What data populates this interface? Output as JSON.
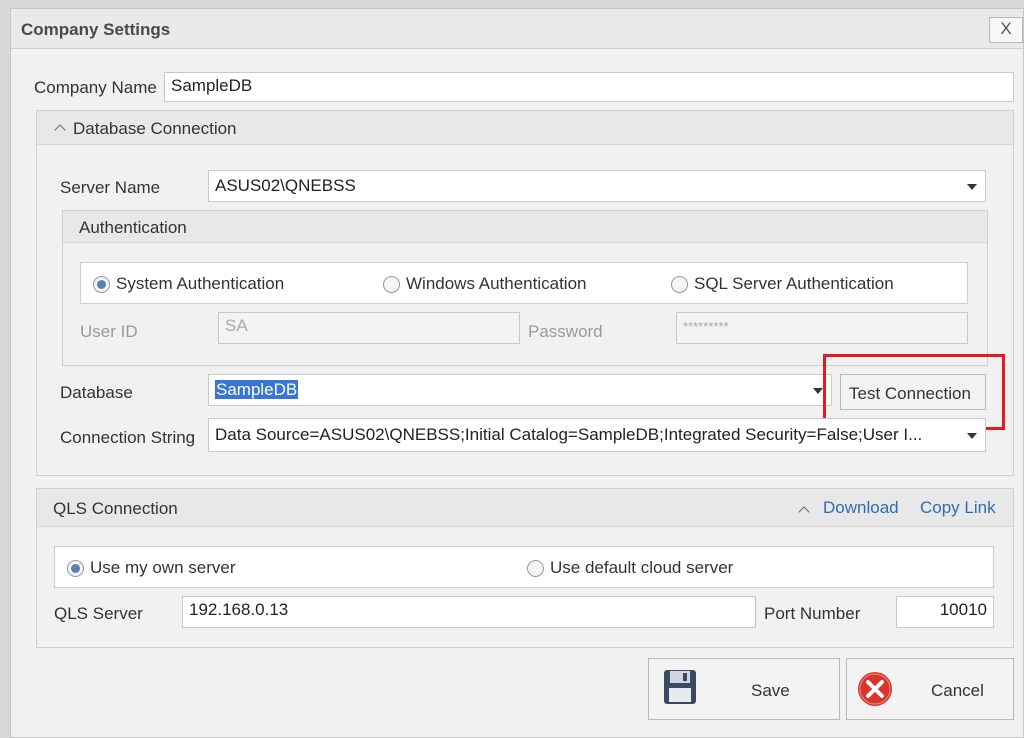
{
  "window": {
    "title": "Company Settings",
    "close_glyph": "X"
  },
  "company": {
    "label": "Company Name",
    "value": "SampleDB"
  },
  "db_group": {
    "title": "Database Connection",
    "server_name": {
      "label": "Server Name",
      "value": "ASUS02\\QNEBSS"
    },
    "authentication": {
      "title": "Authentication",
      "options": [
        "System Authentication",
        "Windows Authentication",
        "SQL Server Authentication"
      ],
      "selected": "System Authentication",
      "user_id": {
        "label": "User ID",
        "value": "SA"
      },
      "password": {
        "label": "Password",
        "value": "*********"
      }
    },
    "database": {
      "label": "Database",
      "value": "SampleDB"
    },
    "test_connection": "Test Connection",
    "connection_string": {
      "label": "Connection String",
      "value": "Data Source=ASUS02\\QNEBSS;Initial Catalog=SampleDB;Integrated Security=False;User I..."
    }
  },
  "qls_group": {
    "title": "QLS Connection",
    "download": "Download",
    "copy_link": "Copy Link",
    "options": [
      "Use my own server",
      "Use default cloud server"
    ],
    "selected": "Use my own server",
    "server": {
      "label": "QLS Server",
      "value": "192.168.0.13"
    },
    "port": {
      "label": "Port Number",
      "value": "10010"
    }
  },
  "buttons": {
    "save": "Save",
    "cancel": "Cancel"
  },
  "colors": {
    "highlight": "#e01b22",
    "link": "#2e6db4",
    "radio_checked": "#5a7fb5",
    "cancel_icon": "#d9362b",
    "save_icon": "#3b4a63"
  },
  "icons": {
    "save": "floppy-disk-icon",
    "cancel": "cancel-x-icon"
  }
}
